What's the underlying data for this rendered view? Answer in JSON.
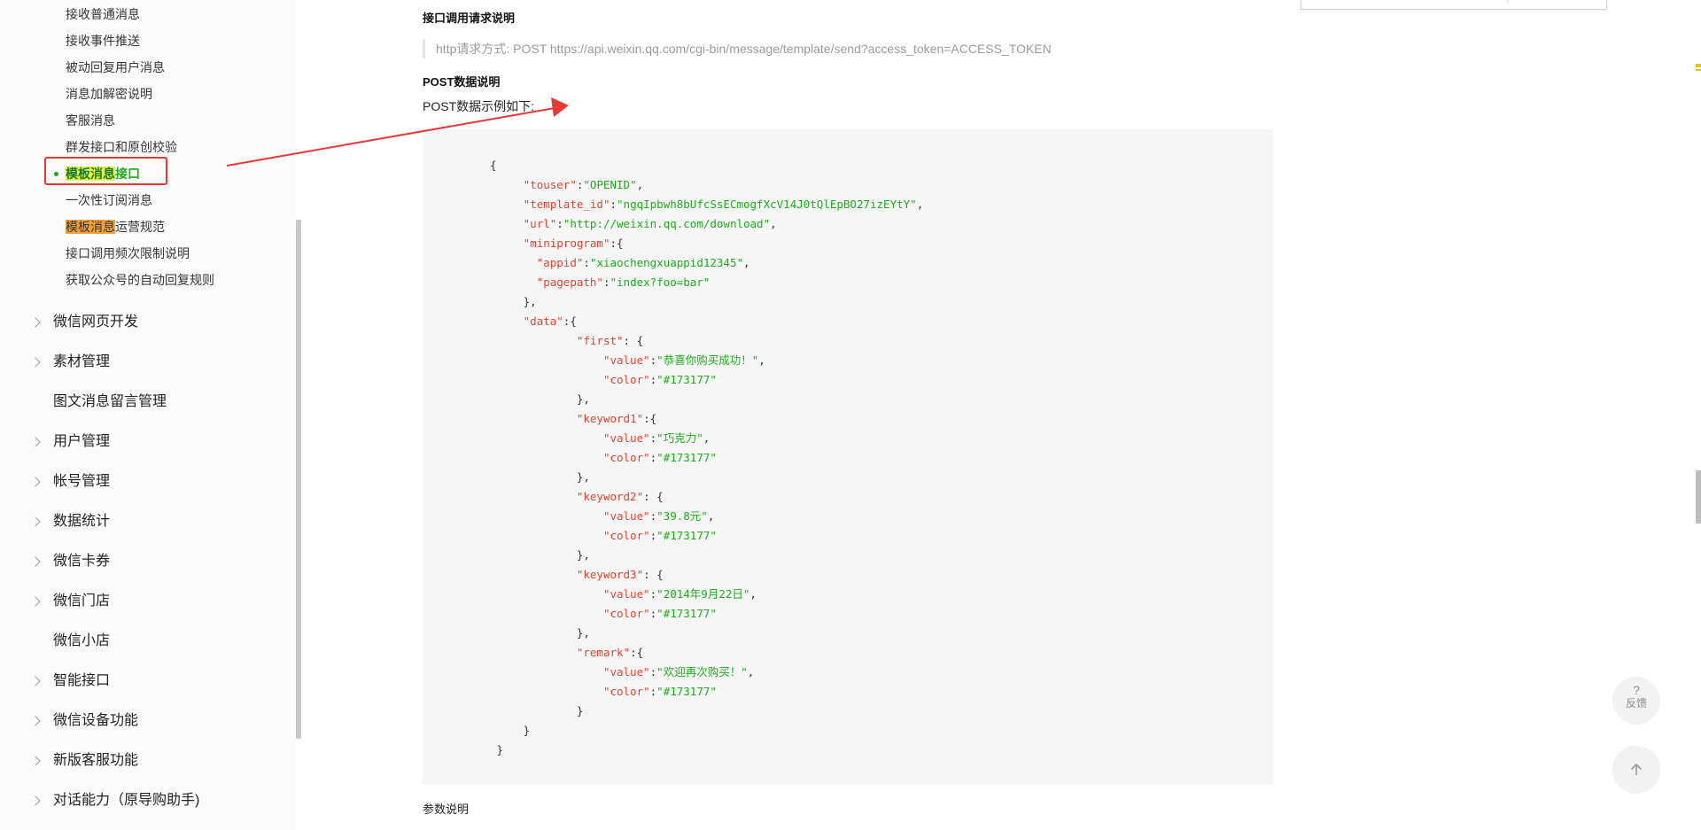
{
  "sidebar": {
    "sub_items": [
      {
        "label": "接收普通消息"
      },
      {
        "label": "接收事件推送"
      },
      {
        "label": "被动回复用户消息"
      },
      {
        "label": "消息加解密说明"
      },
      {
        "label": "客服消息"
      },
      {
        "label": "群发接口和原创校验"
      },
      {
        "label_highlight": "模板消息",
        "label_rest": "接口",
        "active": true
      },
      {
        "label": "一次性订阅消息"
      },
      {
        "label_highlight": "模板消息",
        "label_rest": "运营规范"
      },
      {
        "label": "接口调用频次限制说明"
      },
      {
        "label": "获取公众号的自动回复规则"
      }
    ],
    "main_items": [
      {
        "label": "微信网页开发",
        "expandable": true
      },
      {
        "label": "素材管理",
        "expandable": true
      },
      {
        "label": "图文消息留言管理",
        "expandable": false
      },
      {
        "label": "用户管理",
        "expandable": true
      },
      {
        "label": "帐号管理",
        "expandable": true
      },
      {
        "label": "数据统计",
        "expandable": true
      },
      {
        "label": "微信卡券",
        "expandable": true
      },
      {
        "label": "微信门店",
        "expandable": true
      },
      {
        "label": "微信小店",
        "expandable": false
      },
      {
        "label": "智能接口",
        "expandable": true
      },
      {
        "label": "微信设备功能",
        "expandable": true
      },
      {
        "label": "新版客服功能",
        "expandable": true
      },
      {
        "label": "对话能力（原导购助手)",
        "expandable": true
      }
    ]
  },
  "content": {
    "request_heading": "接口调用请求说明",
    "request_line": "http请求方式: POST https://api.weixin.qq.com/cgi-bin/message/template/send?access_token=ACCESS_TOKEN",
    "post_heading": "POST数据说明",
    "post_intro": "POST数据示例如下:",
    "params_heading": "参数说明",
    "code": {
      "touser": "OPENID",
      "template_id": "ngqIpbwh8bUfcSsECmogfXcV14J0tQlEpBO27izEYtY",
      "url": "http://weixin.qq.com/download",
      "appid": "xiaochengxuappid12345",
      "pagepath": "index?foo=bar",
      "first_value": "恭喜你购买成功！",
      "keyword1_value": "巧克力",
      "keyword2_value": "39.8元",
      "keyword3_value": "2014年9月22日",
      "remark_value": "欢迎再次购买！",
      "color": "#173177"
    }
  },
  "floating": {
    "feedback_glyph": "?",
    "feedback_label": "反馈",
    "back_to_top_icon": "arrow-up-icon"
  },
  "colors": {
    "accent_green": "#1aad19",
    "annotation_red": "#e53935",
    "highlight_yellow": "#e8f23a",
    "highlight_orange": "#f3a23b",
    "code_key": "#e0442f",
    "code_string": "#1aad19"
  }
}
